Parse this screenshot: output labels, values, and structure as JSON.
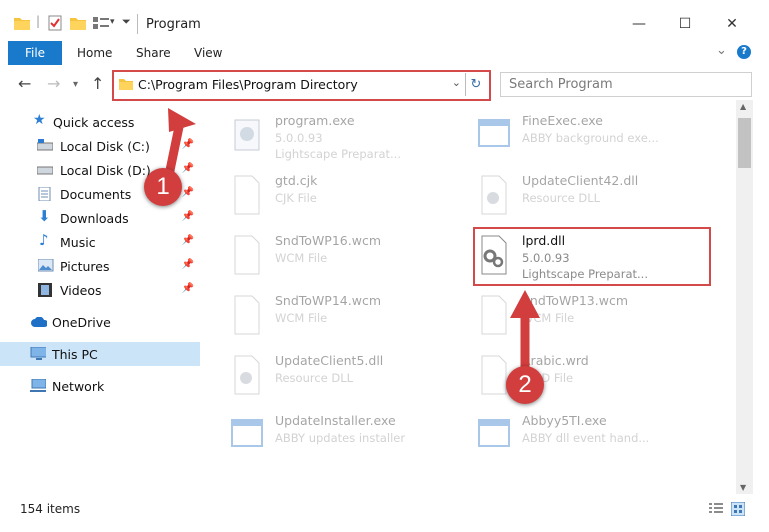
{
  "window": {
    "title": "Program",
    "minimize": "—",
    "maximize": "☐",
    "close": "✕"
  },
  "ribbon": {
    "tabs": [
      "File",
      "Home",
      "Share",
      "View"
    ],
    "help": "?",
    "expand": "⌄"
  },
  "address": {
    "path": "C:\\Program Files\\Program Directory",
    "refresh": "↻",
    "dropdown": "⌄"
  },
  "search": {
    "placeholder": "Search Program"
  },
  "nav": {
    "quick_access": "Quick access",
    "items": [
      {
        "label": "Local Disk (C:)",
        "pinned": true
      },
      {
        "label": "Local Disk (D:)",
        "pinned": true
      },
      {
        "label": "Documents",
        "pinned": true
      },
      {
        "label": "Downloads",
        "pinned": true
      },
      {
        "label": "Music",
        "pinned": true
      },
      {
        "label": "Pictures",
        "pinned": true
      },
      {
        "label": "Videos",
        "pinned": true
      }
    ],
    "onedrive": "OneDrive",
    "thispc": "This PC",
    "network": "Network"
  },
  "files": [
    {
      "name": "program.exe",
      "line1": "5.0.0.93",
      "line2": "Lightscape Preparat...",
      "icon": "exe-icon"
    },
    {
      "name": "FineExec.exe",
      "line1": "ABBY background exe...",
      "line2": "",
      "icon": "app-window-icon"
    },
    {
      "name": "gtd.cjk",
      "line1": "CJK File",
      "line2": "",
      "icon": "blank-file-icon"
    },
    {
      "name": "UpdateClient42.dll",
      "line1": "Resource DLL",
      "line2": "",
      "icon": "dll-icon"
    },
    {
      "name": "SndToWP16.wcm",
      "line1": "WCM File",
      "line2": "",
      "icon": "blank-file-icon"
    },
    {
      "name": "lprd.dll",
      "line1": "5.0.0.93",
      "line2": "Lightscape Preparat...",
      "icon": "dll-gear-icon"
    },
    {
      "name": "SndToWP14.wcm",
      "line1": "WCM File",
      "line2": "",
      "icon": "blank-file-icon"
    },
    {
      "name": "SndToWP13.wcm",
      "line1": "WCM File",
      "line2": "",
      "icon": "blank-file-icon"
    },
    {
      "name": "UpdateClient5.dll",
      "line1": "Resource DLL",
      "line2": "",
      "icon": "dll-icon"
    },
    {
      "name": "Arabic.wrd",
      "line1": "WRD File",
      "line2": "",
      "icon": "blank-file-icon"
    },
    {
      "name": "UpdateInstaller.exe",
      "line1": "ABBY updates installer",
      "line2": "",
      "icon": "app-window-icon"
    },
    {
      "name": "Abbyy5TI.exe",
      "line1": "ABBY dll event hand...",
      "line2": "",
      "icon": "app-window-icon"
    }
  ],
  "status": {
    "count": "154 items"
  },
  "annotations": {
    "step1": "1",
    "step2": "2",
    "color": "#d44a4a"
  }
}
